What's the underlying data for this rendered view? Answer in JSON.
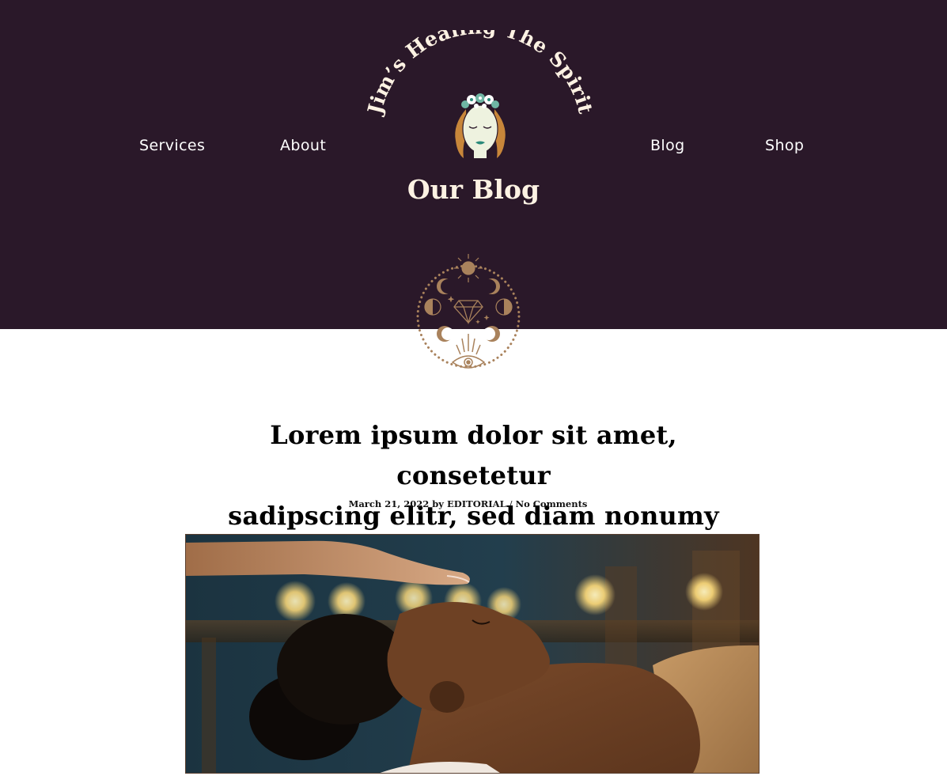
{
  "brand": {
    "name": "Jim's Healing The Spirit",
    "name_display": "Jim’s Healing The Spirit"
  },
  "nav": {
    "items": [
      {
        "label": "Services"
      },
      {
        "label": "About"
      },
      {
        "label": "Blog"
      },
      {
        "label": "Shop"
      }
    ]
  },
  "page": {
    "heading": "Our Blog"
  },
  "post": {
    "title_line1": "Lorem ipsum dolor sit amet, consetetur",
    "title_line2": "sadipscing elitr, sed diam nonumy eirmod",
    "date": "March 21, 2022",
    "by": "by",
    "author": "EDITORIAL",
    "separator": "/",
    "comments": "No Comments"
  },
  "icons": {
    "logo": "woman-face-flower-crown-logo",
    "emblem": "sun-moon-phases-crystal-eye-icon",
    "photo": "reiki-healing-photo"
  },
  "colors": {
    "header_bg": "#2a1829",
    "cream": "#fdf2e3",
    "bronze": "#a9825c",
    "text": "#000000"
  }
}
